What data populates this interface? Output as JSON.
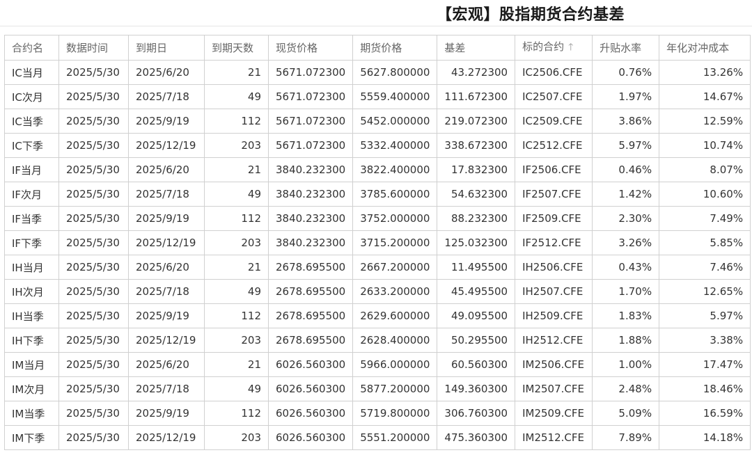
{
  "header": {
    "title": "【宏观】股指期货合约基差"
  },
  "table": {
    "columns": [
      "合约名",
      "数据时间",
      "到期日",
      "到期天数",
      "现货价格",
      "期货价格",
      "基差",
      "标的合约",
      "升贴水率",
      "年化对冲成本"
    ],
    "sort_icon": "arrow-up-icon",
    "rows": [
      [
        "IC当月",
        "2025/5/30",
        "2025/6/20",
        "21",
        "5671.072300",
        "5627.800000",
        "43.272300",
        "IC2506.CFE",
        "0.76%",
        "13.26%"
      ],
      [
        "IC次月",
        "2025/5/30",
        "2025/7/18",
        "49",
        "5671.072300",
        "5559.400000",
        "111.672300",
        "IC2507.CFE",
        "1.97%",
        "14.67%"
      ],
      [
        "IC当季",
        "2025/5/30",
        "2025/9/19",
        "112",
        "5671.072300",
        "5452.000000",
        "219.072300",
        "IC2509.CFE",
        "3.86%",
        "12.59%"
      ],
      [
        "IC下季",
        "2025/5/30",
        "2025/12/19",
        "203",
        "5671.072300",
        "5332.400000",
        "338.672300",
        "IC2512.CFE",
        "5.97%",
        "10.74%"
      ],
      [
        "IF当月",
        "2025/5/30",
        "2025/6/20",
        "21",
        "3840.232300",
        "3822.400000",
        "17.832300",
        "IF2506.CFE",
        "0.46%",
        "8.07%"
      ],
      [
        "IF次月",
        "2025/5/30",
        "2025/7/18",
        "49",
        "3840.232300",
        "3785.600000",
        "54.632300",
        "IF2507.CFE",
        "1.42%",
        "10.60%"
      ],
      [
        "IF当季",
        "2025/5/30",
        "2025/9/19",
        "112",
        "3840.232300",
        "3752.000000",
        "88.232300",
        "IF2509.CFE",
        "2.30%",
        "7.49%"
      ],
      [
        "IF下季",
        "2025/5/30",
        "2025/12/19",
        "203",
        "3840.232300",
        "3715.200000",
        "125.032300",
        "IF2512.CFE",
        "3.26%",
        "5.85%"
      ],
      [
        "IH当月",
        "2025/5/30",
        "2025/6/20",
        "21",
        "2678.695500",
        "2667.200000",
        "11.495500",
        "IH2506.CFE",
        "0.43%",
        "7.46%"
      ],
      [
        "IH次月",
        "2025/5/30",
        "2025/7/18",
        "49",
        "2678.695500",
        "2633.200000",
        "45.495500",
        "IH2507.CFE",
        "1.70%",
        "12.65%"
      ],
      [
        "IH当季",
        "2025/5/30",
        "2025/9/19",
        "112",
        "2678.695500",
        "2629.600000",
        "49.095500",
        "IH2509.CFE",
        "1.83%",
        "5.97%"
      ],
      [
        "IH下季",
        "2025/5/30",
        "2025/12/19",
        "203",
        "2678.695500",
        "2628.400000",
        "50.295500",
        "IH2512.CFE",
        "1.88%",
        "3.38%"
      ],
      [
        "IM当月",
        "2025/5/30",
        "2025/6/20",
        "21",
        "6026.560300",
        "5966.000000",
        "60.560300",
        "IM2506.CFE",
        "1.00%",
        "17.47%"
      ],
      [
        "IM次月",
        "2025/5/30",
        "2025/7/18",
        "49",
        "6026.560300",
        "5877.200000",
        "149.360300",
        "IM2507.CFE",
        "2.48%",
        "18.46%"
      ],
      [
        "IM当季",
        "2025/5/30",
        "2025/9/19",
        "112",
        "6026.560300",
        "5719.800000",
        "306.760300",
        "IM2509.CFE",
        "5.09%",
        "16.59%"
      ],
      [
        "IM下季",
        "2025/5/30",
        "2025/12/19",
        "203",
        "6026.560300",
        "5551.200000",
        "475.360300",
        "IM2512.CFE",
        "7.89%",
        "14.18%"
      ]
    ]
  }
}
